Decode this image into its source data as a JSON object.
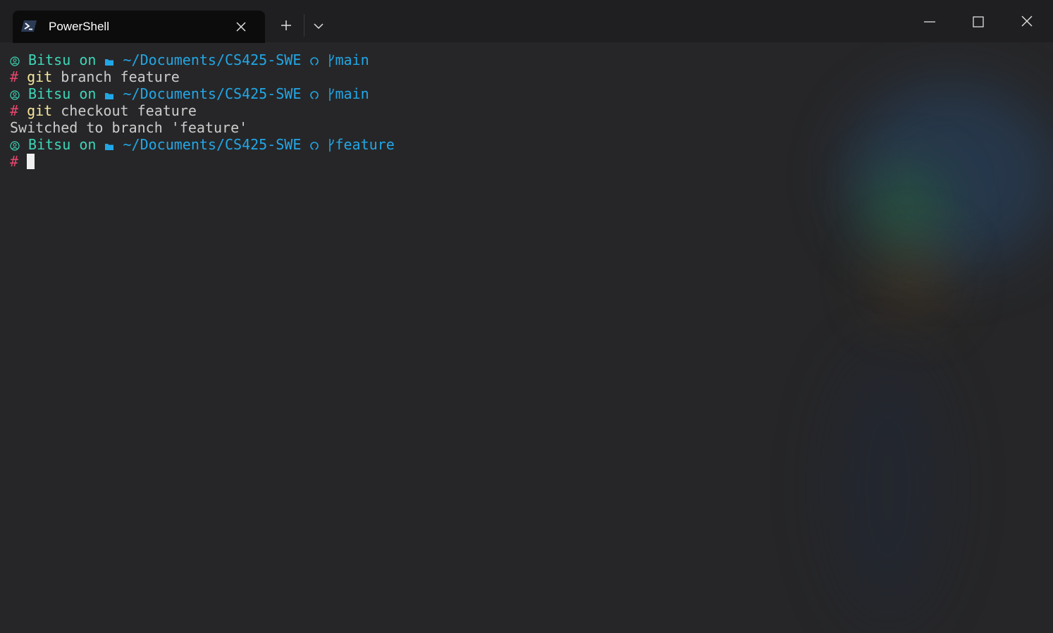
{
  "window": {
    "tab_title": "PowerShell",
    "tab_icon": "powershell-icon",
    "new_tab_icon": "plus-icon",
    "dropdown_icon": "chevron-down-icon",
    "minimize_icon": "minimize-icon",
    "maximize_icon": "maximize-icon",
    "close_icon": "close-icon"
  },
  "prompt": {
    "user": "Bitsu",
    "on": "on",
    "path": "~/Documents/CS425-SWE",
    "hash": "#",
    "user_icon": "user-circle-icon",
    "folder_icon": "folder-icon",
    "github_icon": "github-icon",
    "branch_icon": "git-branch-icon"
  },
  "terminal": {
    "lines": [
      {
        "type": "prompt",
        "branch": "main"
      },
      {
        "type": "command",
        "cmd": "git",
        "args": "branch feature"
      },
      {
        "type": "prompt",
        "branch": "main"
      },
      {
        "type": "command",
        "cmd": "git",
        "args": "checkout feature"
      },
      {
        "type": "output",
        "text": "Switched to branch 'feature'"
      },
      {
        "type": "prompt",
        "branch": "feature"
      },
      {
        "type": "input",
        "cmd": "",
        "args": ""
      }
    ]
  },
  "colors": {
    "user": "#3ed6b8",
    "path": "#22a7e6",
    "hash": "#e8466d",
    "command": "#f4e69c",
    "text": "#cccccc"
  }
}
